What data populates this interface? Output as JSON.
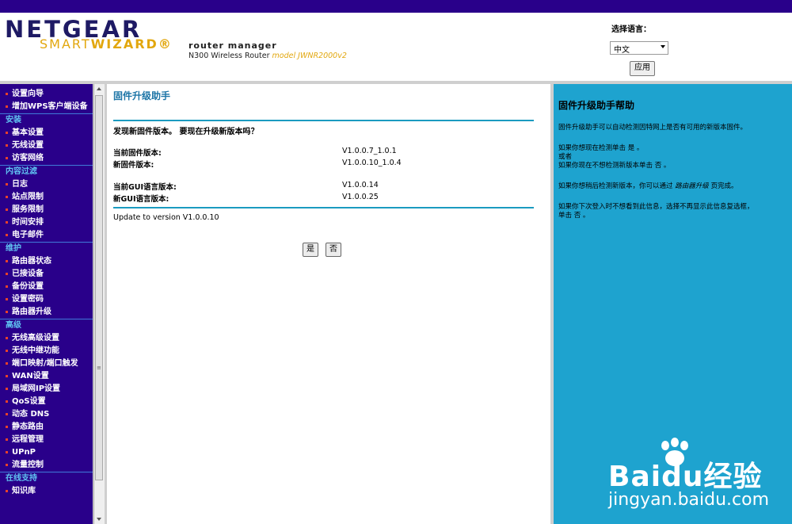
{
  "header": {
    "brand": "NETGEAR",
    "smart": "SMART",
    "wizard": "WIZARD",
    "registered": "®",
    "router_manager": "router manager",
    "router_name": "N300 Wireless Router",
    "model": "model JWNR2000v2",
    "lang_label": "选择语言：",
    "lang_value": "中文",
    "apply_label": "应用"
  },
  "sidebar": {
    "items": [
      {
        "type": "item",
        "label": "设置向导"
      },
      {
        "type": "item",
        "label": "增加WPS客户端设备"
      },
      {
        "type": "cat",
        "label": "安装"
      },
      {
        "type": "item",
        "label": "基本设置"
      },
      {
        "type": "item",
        "label": "无线设置"
      },
      {
        "type": "item",
        "label": "访客网络"
      },
      {
        "type": "cat",
        "label": "内容过滤"
      },
      {
        "type": "item",
        "label": "日志"
      },
      {
        "type": "item",
        "label": "站点限制"
      },
      {
        "type": "item",
        "label": "服务限制"
      },
      {
        "type": "item",
        "label": "时间安排"
      },
      {
        "type": "item",
        "label": "电子邮件"
      },
      {
        "type": "cat",
        "label": "维护"
      },
      {
        "type": "item",
        "label": "路由器状态"
      },
      {
        "type": "item",
        "label": "已接设备"
      },
      {
        "type": "item",
        "label": "备份设置"
      },
      {
        "type": "item",
        "label": "设置密码"
      },
      {
        "type": "item",
        "label": "路由器升级"
      },
      {
        "type": "cat",
        "label": "高级"
      },
      {
        "type": "item",
        "label": "无线高级设置"
      },
      {
        "type": "item",
        "label": "无线中继功能"
      },
      {
        "type": "item",
        "label": "端口映射/端口触发"
      },
      {
        "type": "item",
        "label": "WAN设置"
      },
      {
        "type": "item",
        "label": "局域网IP设置"
      },
      {
        "type": "item",
        "label": "QoS设置"
      },
      {
        "type": "item",
        "label": "动态 DNS"
      },
      {
        "type": "item",
        "label": "静态路由"
      },
      {
        "type": "item",
        "label": "远程管理"
      },
      {
        "type": "item",
        "label": "UPnP"
      },
      {
        "type": "item",
        "label": "流量控制"
      },
      {
        "type": "cat",
        "label": "在线支持"
      },
      {
        "type": "item",
        "label": "知识库"
      }
    ]
  },
  "main": {
    "title": "固件升级助手",
    "question": "发现新固件版本。 要现在升级新版本吗？",
    "current_fw_label": "当前固件版本:",
    "current_fw_value": "V1.0.0.7_1.0.1",
    "new_fw_label": "新固件版本:",
    "new_fw_value": "V1.0.0.10_1.0.4",
    "current_gui_label": "当前GUI语言版本:",
    "current_gui_value": "V1.0.0.14",
    "new_gui_label": "新GUI语言版本:",
    "new_gui_value": "V1.0.0.25",
    "update_note": "Update to version V1.0.0.10",
    "yes_label": "是",
    "no_label": "否"
  },
  "help": {
    "title": "固件升级助手帮助",
    "p1": "固件升级助手可以自动检测因特网上是否有可用的新版本固件。",
    "p2a": "如果你想现在检测单击 是 。",
    "p2b": "或者",
    "p2c": "如果你现在不想检测新版本单击 否 。",
    "p3a": "如果你想稍后检测新版本，你可以通过",
    "p3b": "路由器升级",
    "p3c": "页完成。",
    "p4a": "如果你下次登入时不想看到此信息，选择不再显示此信息复选框，",
    "p4b": "单击 否 。"
  },
  "watermark": {
    "logo": "Baidu经验",
    "url": "jingyan.baidu.com"
  }
}
